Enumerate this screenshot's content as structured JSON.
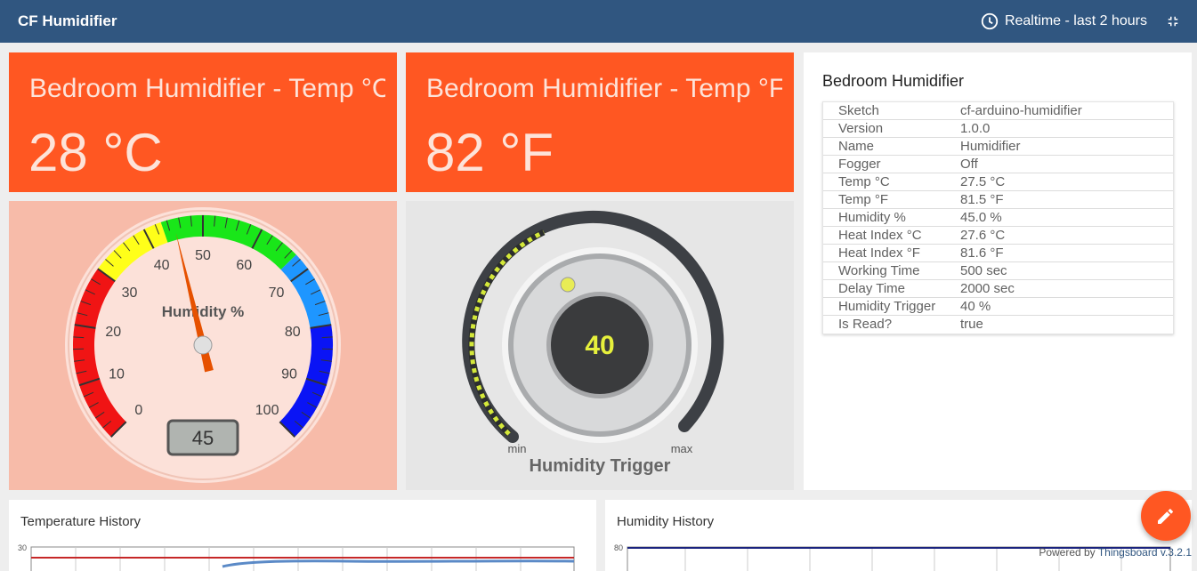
{
  "header": {
    "title": "CF Humidifier",
    "timewindow": "Realtime - last 2 hours"
  },
  "cards": {
    "temp_c": {
      "label": "Bedroom Humidifier - Temp °C",
      "value": "28 °C"
    },
    "temp_f": {
      "label": "Bedroom Humidifier - Temp °F",
      "value": "82 °F"
    }
  },
  "gauge": {
    "title": "Humidity %",
    "value": 45,
    "display": "45",
    "ticks": [
      "0",
      "10",
      "20",
      "30",
      "40",
      "50",
      "60",
      "70",
      "80",
      "90",
      "100"
    ]
  },
  "knob": {
    "title": "Humidity Trigger",
    "value": "40",
    "min_label": "min",
    "max_label": "max"
  },
  "attributes": {
    "title": "Bedroom Humidifier",
    "rows": [
      {
        "key": "Sketch",
        "value": "cf-arduino-humidifier"
      },
      {
        "key": "Version",
        "value": "1.0.0"
      },
      {
        "key": "Name",
        "value": "Humidifier"
      },
      {
        "key": "Fogger",
        "value": "Off"
      },
      {
        "key": "Temp °C",
        "value": "27.5 °C"
      },
      {
        "key": "Temp °F",
        "value": "81.5 °F"
      },
      {
        "key": "Humidity %",
        "value": "45.0 %"
      },
      {
        "key": "Heat Index °C",
        "value": "27.6 °C"
      },
      {
        "key": "Heat Index °F",
        "value": "81.6 °F"
      },
      {
        "key": "Working Time",
        "value": "500 sec"
      },
      {
        "key": "Delay Time",
        "value": "2000 sec"
      },
      {
        "key": "Humidity Trigger",
        "value": "40 %"
      },
      {
        "key": "Is Read?",
        "value": "true"
      }
    ]
  },
  "history": {
    "temperature": {
      "title": "Temperature History",
      "ymax_label": "30"
    },
    "humidity": {
      "title": "Humidity History",
      "ymax_label": "80"
    }
  },
  "footer": {
    "powered_prefix": "Powered by ",
    "powered_link": "Thingsboard v.3.2.1"
  },
  "colors": {
    "header": "#305680",
    "accent": "#ff5722"
  }
}
